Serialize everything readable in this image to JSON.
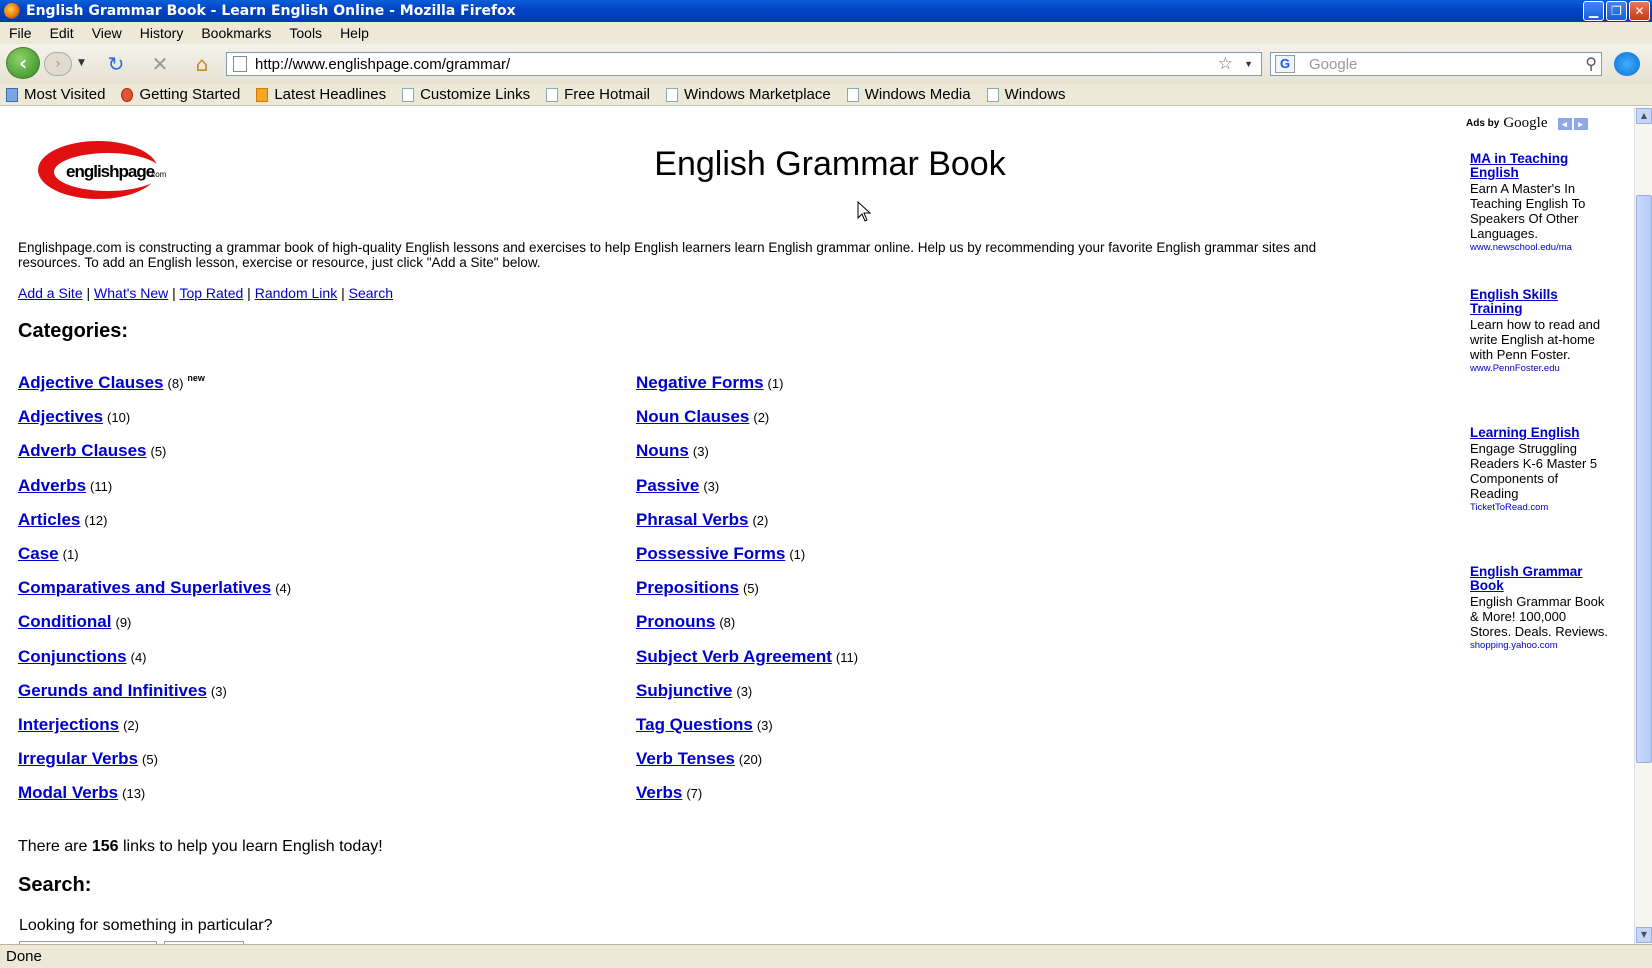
{
  "window": {
    "title": "English Grammar Book - Learn English Online - Mozilla Firefox"
  },
  "menu": [
    "File",
    "Edit",
    "View",
    "History",
    "Bookmarks",
    "Tools",
    "Help"
  ],
  "nav": {
    "url": "http://www.englishpage.com/grammar/",
    "search_placeholder": "Google"
  },
  "bookmarks": [
    "Most Visited",
    "Getting Started",
    "Latest Headlines",
    "Customize Links",
    "Free Hotmail",
    "Windows Marketplace",
    "Windows Media",
    "Windows"
  ],
  "page": {
    "logo_text": "englishpage",
    "logo_suffix": ".com",
    "title": "English Grammar Book",
    "intro": "Englishpage.com is constructing a grammar book of high-quality English lessons and exercises to help English learners learn English grammar online. Help us by recommending your favorite English grammar sites and resources. To add an English lesson, exercise or resource, just click \"Add a Site\" below.",
    "top_links": [
      "Add a Site",
      "What's New",
      "Top Rated",
      "Random Link",
      "Search"
    ],
    "categories_heading": "Categories:",
    "new_label": "new",
    "left_categories": [
      {
        "name": "Adjective Clauses",
        "count": "(8)"
      },
      {
        "name": "Adjectives",
        "count": "(10)"
      },
      {
        "name": "Adverb Clauses",
        "count": "(5)"
      },
      {
        "name": "Adverbs",
        "count": "(11)"
      },
      {
        "name": "Articles",
        "count": "(12)"
      },
      {
        "name": "Case",
        "count": "(1)"
      },
      {
        "name": "Comparatives and Superlatives",
        "count": "(4)"
      },
      {
        "name": "Conditional",
        "count": "(9)"
      },
      {
        "name": "Conjunctions",
        "count": "(4)"
      },
      {
        "name": "Gerunds and Infinitives",
        "count": "(3)"
      },
      {
        "name": "Interjections",
        "count": "(2)"
      },
      {
        "name": "Irregular Verbs",
        "count": "(5)"
      },
      {
        "name": "Modal Verbs",
        "count": "(13)"
      }
    ],
    "right_categories": [
      {
        "name": "Negative Forms",
        "count": "(1)"
      },
      {
        "name": "Noun Clauses",
        "count": "(2)"
      },
      {
        "name": "Nouns",
        "count": "(3)"
      },
      {
        "name": "Passive",
        "count": "(3)"
      },
      {
        "name": "Phrasal Verbs",
        "count": "(2)"
      },
      {
        "name": "Possessive Forms",
        "count": "(1)"
      },
      {
        "name": "Prepositions",
        "count": "(5)"
      },
      {
        "name": "Pronouns",
        "count": "(8)"
      },
      {
        "name": "Subject Verb Agreement",
        "count": "(11)"
      },
      {
        "name": "Subjunctive",
        "count": "(3)"
      },
      {
        "name": "Tag Questions",
        "count": "(3)"
      },
      {
        "name": "Verb Tenses",
        "count": "(20)"
      },
      {
        "name": "Verbs",
        "count": "(7)"
      }
    ],
    "summary_pre": "There are ",
    "summary_count": "156",
    "summary_post": " links to help you learn English today!",
    "search_heading": "Search:",
    "search_prompt": "Looking for something in particular?"
  },
  "ads": {
    "label": "Ads by",
    "brand": "Google",
    "items": [
      {
        "title": "MA in Teaching English",
        "body": "Earn A Master's In Teaching English To Speakers Of Other Languages.",
        "url": "www.newschool.edu/ma"
      },
      {
        "title": "English Skills Training",
        "body": "Learn how to read and write English at-home with Penn Foster.",
        "url": "www.PennFoster.edu"
      },
      {
        "title": "Learning English",
        "body": "Engage Struggling Readers K-6 Master 5 Components of Reading",
        "url": "TicketToRead.com"
      },
      {
        "title": "English Grammar Book",
        "body": "English Grammar Book & More! 100,000 Stores. Deals. Reviews.",
        "url": "shopping.yahoo.com"
      }
    ]
  },
  "status": "Done",
  "colors": {
    "link": "#0000cc",
    "logo_red": "#e01010",
    "titlebar": "#0245c4"
  }
}
